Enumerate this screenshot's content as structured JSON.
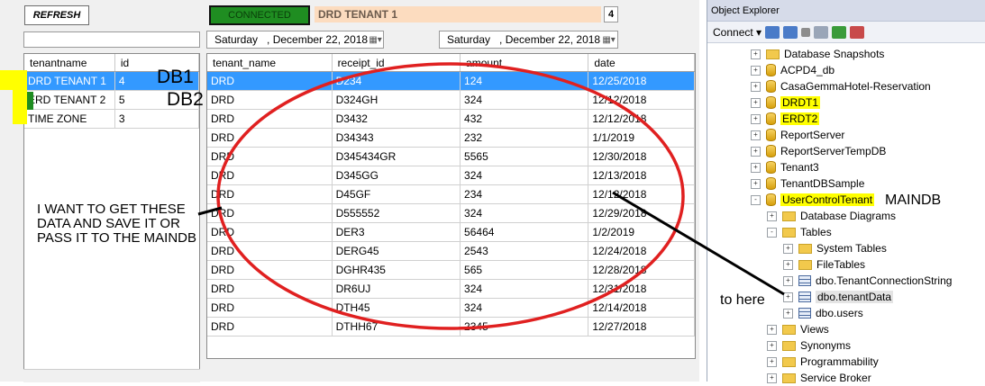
{
  "toolbar": {
    "refresh_label": "REFRESH",
    "status": "CONNECTED",
    "tenant_name": "DRD TENANT 1",
    "count": "4"
  },
  "dates": {
    "from": "Saturday   , December 22, 2018",
    "to": "Saturday   , December 22, 2018"
  },
  "tenants": {
    "columns": [
      "tenantname",
      "id"
    ],
    "rows": [
      [
        "DRD TENANT 1",
        "4"
      ],
      [
        "ERD TENANT 2",
        "5"
      ],
      [
        "TIME ZONE",
        "3"
      ]
    ]
  },
  "receipts": {
    "columns": [
      "tenant_name",
      "receipt_id",
      "amount",
      "date"
    ],
    "rows": [
      [
        "DRD",
        "D234",
        "124",
        "12/25/2018"
      ],
      [
        "DRD",
        "D324GH",
        "324",
        "12/12/2018"
      ],
      [
        "DRD",
        "D3432",
        "432",
        "12/12/2018"
      ],
      [
        "DRD",
        "D34343",
        "232",
        "1/1/2019"
      ],
      [
        "DRD",
        "D345434GR",
        "5565",
        "12/30/2018"
      ],
      [
        "DRD",
        "D345GG",
        "324",
        "12/13/2018"
      ],
      [
        "DRD",
        "D45GF",
        "234",
        "12/12/2018"
      ],
      [
        "DRD",
        "D555552",
        "324",
        "12/29/2018"
      ],
      [
        "DRD",
        "DER3",
        "56464",
        "1/2/2019"
      ],
      [
        "DRD",
        "DERG45",
        "2543",
        "12/24/2018"
      ],
      [
        "DRD",
        "DGHR435",
        "565",
        "12/28/2018"
      ],
      [
        "DRD",
        "DR6UJ",
        "324",
        "12/31/2018"
      ],
      [
        "DRD",
        "DTH45",
        "324",
        "12/14/2018"
      ],
      [
        "DRD",
        "DTHH67",
        "2345",
        "12/27/2018"
      ]
    ]
  },
  "object_explorer": {
    "title": "Object Explorer",
    "connect_label": "Connect",
    "nodes": [
      {
        "label": "Database Snapshots",
        "icon": "folder-icon",
        "level": 0,
        "exp": "+"
      },
      {
        "label": "ACPD4_db",
        "icon": "database-icon",
        "level": 0,
        "exp": "+"
      },
      {
        "label": "CasaGemmaHotel-Reservation",
        "icon": "database-icon",
        "level": 0,
        "exp": "+"
      },
      {
        "label": "DRDT1",
        "icon": "database-icon",
        "level": 0,
        "exp": "+",
        "hl": true
      },
      {
        "label": "ERDT2",
        "icon": "database-icon",
        "level": 0,
        "exp": "+",
        "hl": true
      },
      {
        "label": "ReportServer",
        "icon": "database-icon",
        "level": 0,
        "exp": "+"
      },
      {
        "label": "ReportServerTempDB",
        "icon": "database-icon",
        "level": 0,
        "exp": "+"
      },
      {
        "label": "Tenant3",
        "icon": "database-icon",
        "level": 0,
        "exp": "+"
      },
      {
        "label": "TenantDBSample",
        "icon": "database-icon",
        "level": 0,
        "exp": "+"
      },
      {
        "label": "UserControlTenant",
        "icon": "database-icon",
        "level": 0,
        "exp": "-",
        "hl": true
      },
      {
        "label": "Database Diagrams",
        "icon": "folder-icon",
        "level": 1,
        "exp": "+"
      },
      {
        "label": "Tables",
        "icon": "folder-icon",
        "level": 1,
        "exp": "-"
      },
      {
        "label": "System Tables",
        "icon": "folder-icon",
        "level": 2,
        "exp": "+"
      },
      {
        "label": "FileTables",
        "icon": "folder-icon",
        "level": 2,
        "exp": "+"
      },
      {
        "label": "dbo.TenantConnectionString",
        "icon": "table-icon",
        "level": 2,
        "exp": "+"
      },
      {
        "label": "dbo.tenantData",
        "icon": "table-icon",
        "level": 2,
        "exp": "+",
        "sel": true
      },
      {
        "label": "dbo.users",
        "icon": "table-icon",
        "level": 2,
        "exp": "+"
      },
      {
        "label": "Views",
        "icon": "folder-icon",
        "level": 1,
        "exp": "+"
      },
      {
        "label": "Synonyms",
        "icon": "folder-icon",
        "level": 1,
        "exp": "+"
      },
      {
        "label": "Programmability",
        "icon": "folder-icon",
        "level": 1,
        "exp": "+"
      },
      {
        "label": "Service Broker",
        "icon": "folder-icon",
        "level": 1,
        "exp": "+"
      }
    ]
  },
  "annotations": {
    "db1": "DB1",
    "db2": "DB2",
    "note": [
      "I WANT TO GET THESE",
      "DATA AND SAVE IT OR",
      "PASS IT TO THE MAINDB"
    ],
    "maindb": "MAINDB",
    "to_here": "to here"
  },
  "colors": {
    "selection": "#3399ff",
    "connected": "#1f8d21",
    "highlight": "#ffff00",
    "circle": "#e02020"
  }
}
